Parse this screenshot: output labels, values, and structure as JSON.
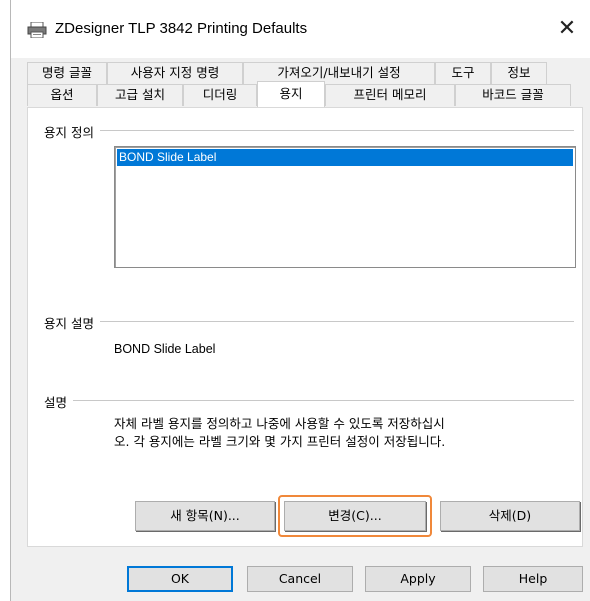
{
  "window": {
    "title": "ZDesigner TLP 3842 Printing Defaults",
    "close_glyph": "✕"
  },
  "tabs_row1": [
    "명령 글꼴",
    "사용자 지정 명령",
    "가져오기/내보내기 설정",
    "도구",
    "정보"
  ],
  "tabs_row2": [
    "옵션",
    "고급 설치",
    "디더링",
    "용지",
    "프린터 메모리",
    "바코드 글꼴"
  ],
  "active_tab": "용지",
  "paper_definition": {
    "heading": "용지 정의",
    "items": [
      "BOND Slide Label"
    ]
  },
  "paper_description": {
    "heading": "용지 설명",
    "value": "BOND Slide Label"
  },
  "explanation": {
    "heading": "설명",
    "line1": "자체 라벨 용지를 정의하고 나중에 사용할 수 있도록 저장하십시",
    "line2": "오. 각 용지에는 라벨 크기와 몇 가지 프린터 설정이 저장됩니다."
  },
  "panel_buttons": {
    "new": "새 항목(N)...",
    "change": "변경(C)...",
    "delete": "삭제(D)"
  },
  "dialog_buttons": {
    "ok": "OK",
    "cancel": "Cancel",
    "apply": "Apply",
    "help": "Help"
  },
  "colors": {
    "selection": "#0078d7",
    "highlight": "#f0883a"
  }
}
